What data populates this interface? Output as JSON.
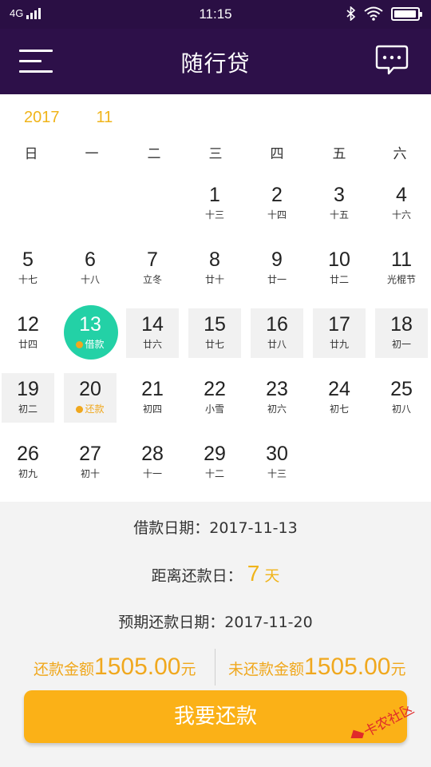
{
  "status_bar": {
    "network": "4G",
    "time": "11:15",
    "battery_level": 0.95
  },
  "app_bar": {
    "title": "随行贷",
    "menu_icon": "menu-icon",
    "message_icon": "chat-bubble-icon"
  },
  "calendar": {
    "year": "2017",
    "month": "11",
    "weekdays": [
      "日",
      "一",
      "二",
      "三",
      "四",
      "五",
      "六"
    ],
    "first_weekday_index": 3,
    "days": [
      {
        "day": "1",
        "lunar": "十三"
      },
      {
        "day": "2",
        "lunar": "十四"
      },
      {
        "day": "3",
        "lunar": "十五"
      },
      {
        "day": "4",
        "lunar": "十六"
      },
      {
        "day": "5",
        "lunar": "十七"
      },
      {
        "day": "6",
        "lunar": "十八"
      },
      {
        "day": "7",
        "lunar": "立冬"
      },
      {
        "day": "8",
        "lunar": "廿十"
      },
      {
        "day": "9",
        "lunar": "廿一"
      },
      {
        "day": "10",
        "lunar": "廿二"
      },
      {
        "day": "11",
        "lunar": "光棍节"
      },
      {
        "day": "12",
        "lunar": "廿四"
      },
      {
        "day": "13",
        "lunar": "借款",
        "marker": "dot",
        "selected": true
      },
      {
        "day": "14",
        "lunar": "廿六",
        "shaded": true
      },
      {
        "day": "15",
        "lunar": "廿七",
        "shaded": true
      },
      {
        "day": "16",
        "lunar": "廿八",
        "shaded": true
      },
      {
        "day": "17",
        "lunar": "廿九",
        "shaded": true
      },
      {
        "day": "18",
        "lunar": "初一",
        "shaded": true
      },
      {
        "day": "19",
        "lunar": "初二",
        "shaded": true
      },
      {
        "day": "20",
        "lunar": "还款",
        "marker": "dot",
        "shaded": true
      },
      {
        "day": "21",
        "lunar": "初四"
      },
      {
        "day": "22",
        "lunar": "小雪"
      },
      {
        "day": "23",
        "lunar": "初六"
      },
      {
        "day": "24",
        "lunar": "初七"
      },
      {
        "day": "25",
        "lunar": "初八"
      },
      {
        "day": "26",
        "lunar": "初九"
      },
      {
        "day": "27",
        "lunar": "初十"
      },
      {
        "day": "28",
        "lunar": "十一"
      },
      {
        "day": "29",
        "lunar": "十二"
      },
      {
        "day": "30",
        "lunar": "十三"
      }
    ]
  },
  "loan_info": {
    "loan_date_label": "借款日期：",
    "loan_date": "2017-11-13",
    "days_left_label": "距离还款日：",
    "days_left": "7",
    "days_unit": "天",
    "due_date_label": "预期还款日期：",
    "due_date": "2017-11-20",
    "repay_amount_label": "还款金额",
    "repay_amount": "1505.00",
    "repay_amount_unit": "元",
    "unpaid_amount_label": "未还款金额",
    "unpaid_amount": "1505.00",
    "unpaid_amount_unit": "元"
  },
  "actions": {
    "repay_button": "我要还款"
  },
  "watermark": {
    "text": "卡农社区"
  },
  "colors": {
    "header_bg": "#2d1049",
    "accent_gold": "#f0b41a",
    "selected_green": "#23d1a6",
    "button_orange": "#fbb117"
  }
}
